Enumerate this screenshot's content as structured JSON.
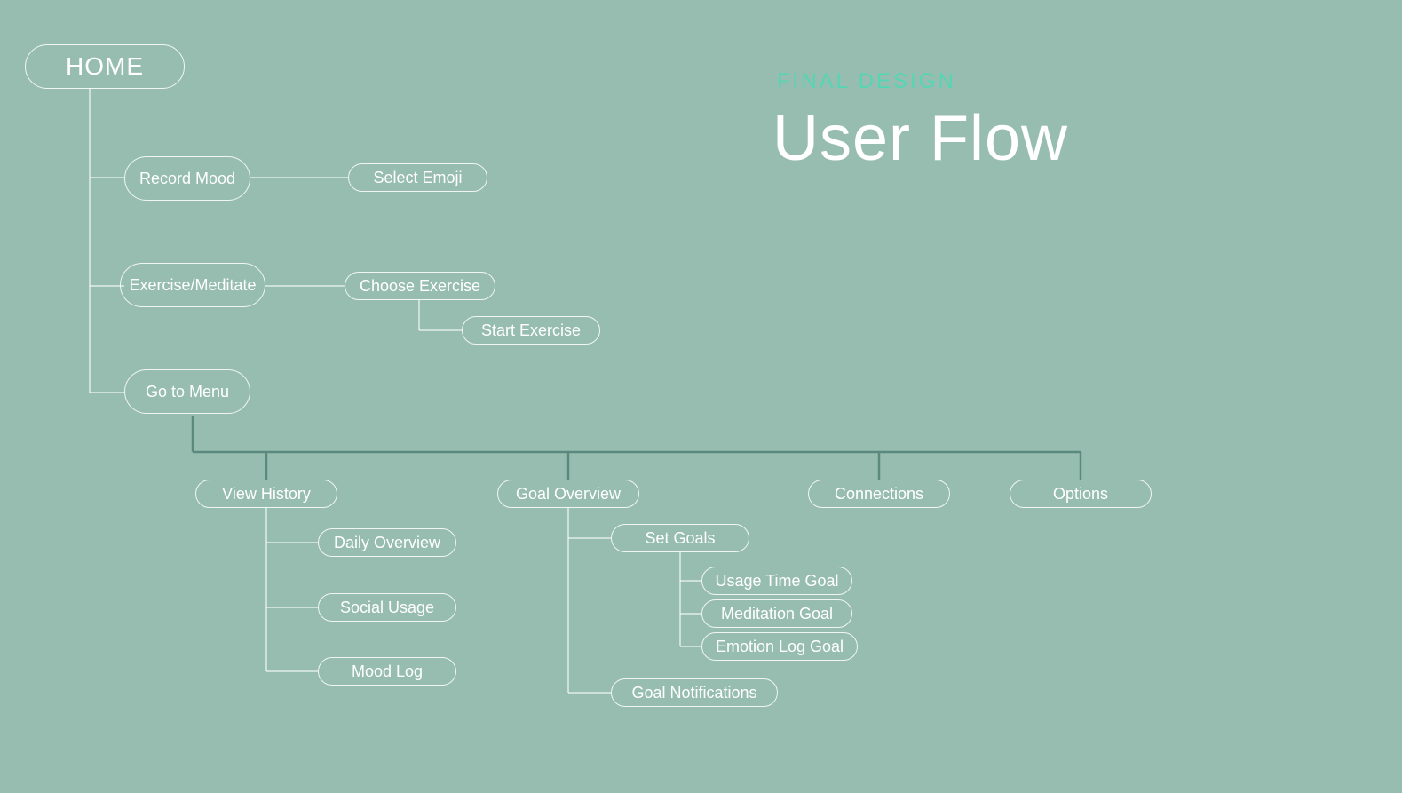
{
  "header": {
    "subtitle": "FINAL DESIGN",
    "title": "User Flow"
  },
  "nodes": {
    "home": "HOME",
    "record_mood": "Record Mood",
    "select_emoji": "Select Emoji",
    "exercise_meditate": "Exercise/Meditate",
    "choose_exercise": "Choose Exercise",
    "start_exercise": "Start Exercise",
    "go_to_menu": "Go to Menu",
    "view_history": "View History",
    "daily_overview": "Daily Overview",
    "social_usage": "Social Usage",
    "mood_log": "Mood Log",
    "goal_overview": "Goal Overview",
    "set_goals": "Set Goals",
    "usage_time_goal": "Usage Time Goal",
    "meditation_goal": "Meditation Goal",
    "emotion_log_goal": "Emotion Log Goal",
    "goal_notifications": "Goal Notifications",
    "connections": "Connections",
    "options": "Options"
  }
}
